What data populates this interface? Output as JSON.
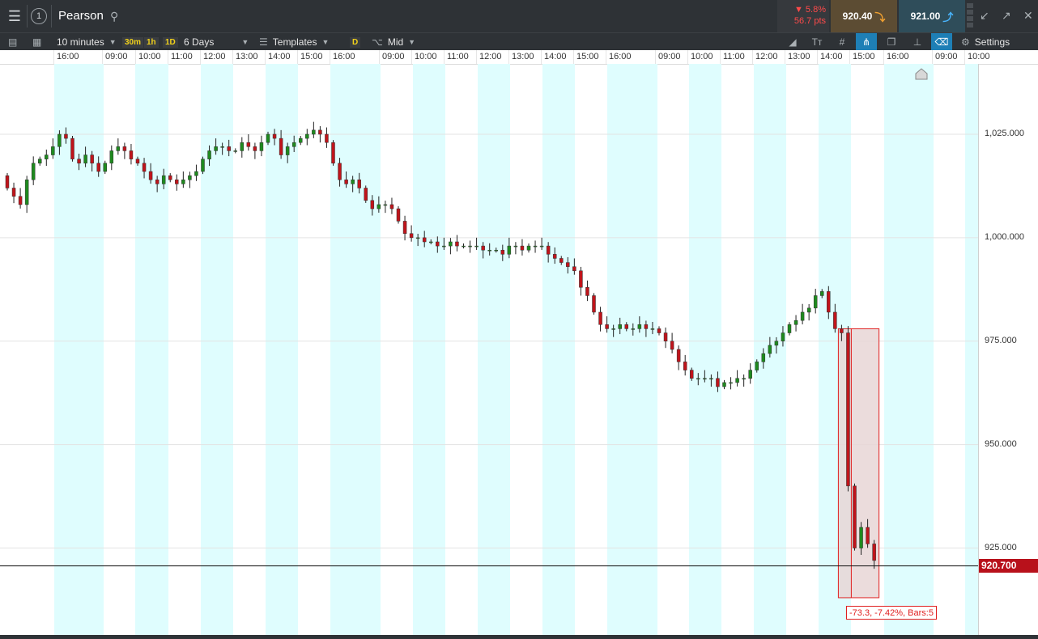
{
  "header": {
    "symbol": "Pearson",
    "instrument_number": "1",
    "change_percent": "5.8%",
    "change_points": "56.7 pts",
    "sell_price": "920.40",
    "buy_price": "921.00"
  },
  "toolbar": {
    "interval": "10 minutes",
    "quick_intervals": [
      "30m",
      "1h",
      "1D"
    ],
    "range": "6 Days",
    "templates": "Templates",
    "d_tag": "D",
    "price_type": "Mid",
    "settings": "Settings"
  },
  "time_axis": {
    "labels": [
      "16:00",
      "09:00",
      "10:00",
      "11:00",
      "12:00",
      "13:00",
      "14:00",
      "15:00",
      "16:00",
      "09:00",
      "10:00",
      "11:00",
      "12:00",
      "13:00",
      "14:00",
      "15:00",
      "16:00",
      "09:00",
      "10:00",
      "11:00",
      "12:00",
      "13:00",
      "14:00",
      "15:00",
      "16:00",
      "09:00",
      "10:00"
    ]
  },
  "price_axis": {
    "labels": [
      "1,025.000",
      "1,000.000",
      "975.000",
      "950.000",
      "925.000"
    ]
  },
  "current_price": "920.700",
  "measure": {
    "label": "-73.3, -7.42%, Bars:5"
  },
  "colors": {
    "up": "#1e8a1e",
    "down": "#c0141b",
    "session_band": "#dffdfe",
    "measure_fill": "#e8d6d6",
    "measure_stroke": "#e02020"
  },
  "chart_data": {
    "type": "candlestick",
    "interval": "10 minutes",
    "ylim": [
      904,
      1042
    ],
    "y_ticks": [
      925,
      950,
      975,
      1000,
      1025
    ],
    "current_price": 920.7,
    "close_series": [
      1012,
      1010,
      1008,
      1014,
      1018,
      1019,
      1020,
      1022,
      1025,
      1024,
      1019,
      1018,
      1020,
      1018,
      1016,
      1018,
      1021,
      1022,
      1021,
      1019,
      1018,
      1016,
      1014,
      1013,
      1015,
      1014,
      1013,
      1014,
      1015,
      1016,
      1019,
      1021,
      1022,
      1022,
      1021,
      1021,
      1023,
      1022,
      1021,
      1023,
      1025,
      1024,
      1020,
      1022,
      1023,
      1024,
      1025,
      1026,
      1025,
      1023,
      1018,
      1014,
      1013,
      1014,
      1012,
      1009,
      1007,
      1008,
      1008,
      1007,
      1004,
      1001,
      1000,
      1000,
      999,
      999,
      998,
      998,
      999,
      998,
      998,
      998,
      998,
      997,
      997,
      997,
      996,
      998,
      998,
      997,
      998,
      998,
      998,
      996,
      995,
      994,
      993,
      992,
      988,
      986,
      982,
      979,
      978,
      978,
      979,
      978,
      978,
      979,
      978,
      978,
      977,
      975,
      973,
      970,
      968,
      966,
      966,
      966,
      966,
      964,
      965,
      965,
      966,
      966,
      968,
      970,
      972,
      974,
      975,
      977,
      979,
      980,
      982,
      983,
      986,
      987,
      982,
      978,
      977,
      940,
      925,
      930,
      926,
      922
    ],
    "sessions": [
      {
        "start": "16:00",
        "end": "16:30"
      },
      {
        "start": "09:00",
        "end": "16:30"
      },
      {
        "start": "09:00",
        "end": "16:30"
      },
      {
        "start": "09:00",
        "end": "16:30"
      },
      {
        "start": "09:00",
        "end": "10:00"
      }
    ],
    "measurement": {
      "change": -73.3,
      "change_percent": -7.42,
      "bars": 5
    }
  }
}
